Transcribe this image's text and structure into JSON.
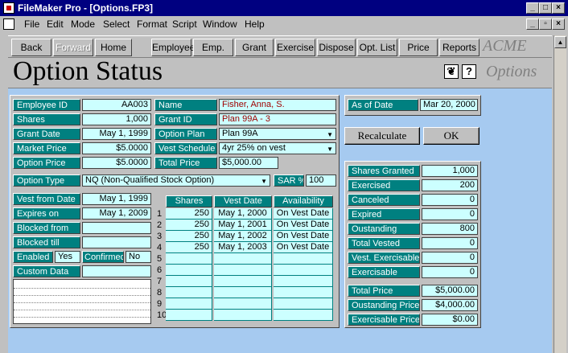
{
  "window": {
    "title": "FileMaker Pro - [Options.FP3]"
  },
  "menu": [
    "File",
    "Edit",
    "Mode",
    "Select",
    "Format",
    "Script",
    "Window",
    "Help"
  ],
  "toolbar": {
    "back": "Back",
    "forward": "Forward",
    "home": "Home",
    "employee": "Employee",
    "emp_list": "Emp. List",
    "grant": "Grant",
    "exercise": "Exercise",
    "dispose": "Dispose",
    "opt_list": "Opt. List",
    "price": "Price",
    "reports": "Reports",
    "brand": "ACME"
  },
  "header": {
    "title": "Option Status",
    "section": "Options"
  },
  "form": {
    "employee_id_label": "Employee ID",
    "employee_id": "AA003",
    "shares_label": "Shares",
    "shares": "1,000",
    "grant_date_label": "Grant Date",
    "grant_date": "May 1, 1999",
    "market_price_label": "Market Price",
    "market_price": "$5.0000",
    "option_price_label": "Option Price",
    "option_price": "$5.0000",
    "name_label": "Name",
    "name": "Fisher, Anna, S.",
    "grant_id_label": "Grant ID",
    "grant_id": "Plan 99A - 3",
    "option_plan_label": "Option Plan",
    "option_plan": "Plan 99A",
    "vest_schedule_label": "Vest Schedule",
    "vest_schedule": "4yr 25% on vest",
    "total_price_label": "Total Price",
    "total_price": "$5,000.00",
    "option_type_label": "Option Type",
    "option_type": "NQ    (Non-Qualified Stock Option)",
    "sar_label": "SAR %",
    "sar": "100",
    "vest_from_label": "Vest from Date",
    "vest_from": "May 1, 1999",
    "expires_label": "Expires on",
    "expires": "May 1, 2009",
    "blocked_from_label": "Blocked from",
    "blocked_from": "",
    "blocked_till_label": "Blocked till",
    "blocked_till": "",
    "enabled_label": "Enabled",
    "enabled": "Yes",
    "confirmed_label": "Confirmed",
    "confirmed": "No",
    "custom_data_label": "Custom Data",
    "custom_data": ""
  },
  "vest_table": {
    "headers": [
      "Shares",
      "Vest Date",
      "Availability"
    ],
    "rows": [
      {
        "n": "1",
        "shares": "250",
        "date": "May  1, 2000",
        "avail": "On Vest Date"
      },
      {
        "n": "2",
        "shares": "250",
        "date": "May  1, 2001",
        "avail": "On Vest Date"
      },
      {
        "n": "3",
        "shares": "250",
        "date": "May  1, 2002",
        "avail": "On Vest Date"
      },
      {
        "n": "4",
        "shares": "250",
        "date": "May  1, 2003",
        "avail": "On Vest Date"
      },
      {
        "n": "5",
        "shares": "",
        "date": "",
        "avail": ""
      },
      {
        "n": "6",
        "shares": "",
        "date": "",
        "avail": ""
      },
      {
        "n": "7",
        "shares": "",
        "date": "",
        "avail": ""
      },
      {
        "n": "8",
        "shares": "",
        "date": "",
        "avail": ""
      },
      {
        "n": "9",
        "shares": "",
        "date": "",
        "avail": ""
      },
      {
        "n": "10",
        "shares": "",
        "date": "",
        "avail": ""
      }
    ]
  },
  "right": {
    "as_of_label": "As of Date",
    "as_of": "Mar 20, 2000",
    "recalc": "Recalculate",
    "ok": "OK",
    "stats": [
      {
        "label": "Shares Granted",
        "value": "1,000"
      },
      {
        "label": "Exercised",
        "value": "200"
      },
      {
        "label": "Canceled",
        "value": "0"
      },
      {
        "label": "Expired",
        "value": "0"
      },
      {
        "label": "Oustanding",
        "value": "800"
      },
      {
        "label": "Total Vested",
        "value": "0"
      },
      {
        "label": "Vest. Exercisable",
        "value": "0"
      },
      {
        "label": "Exercisable",
        "value": "0"
      }
    ],
    "prices": [
      {
        "label": "Total Price",
        "value": "$5,000.00"
      },
      {
        "label": "Oustanding Price",
        "value": "$4,000.00"
      },
      {
        "label": "Exercisable Price",
        "value": "$0.00"
      }
    ]
  }
}
